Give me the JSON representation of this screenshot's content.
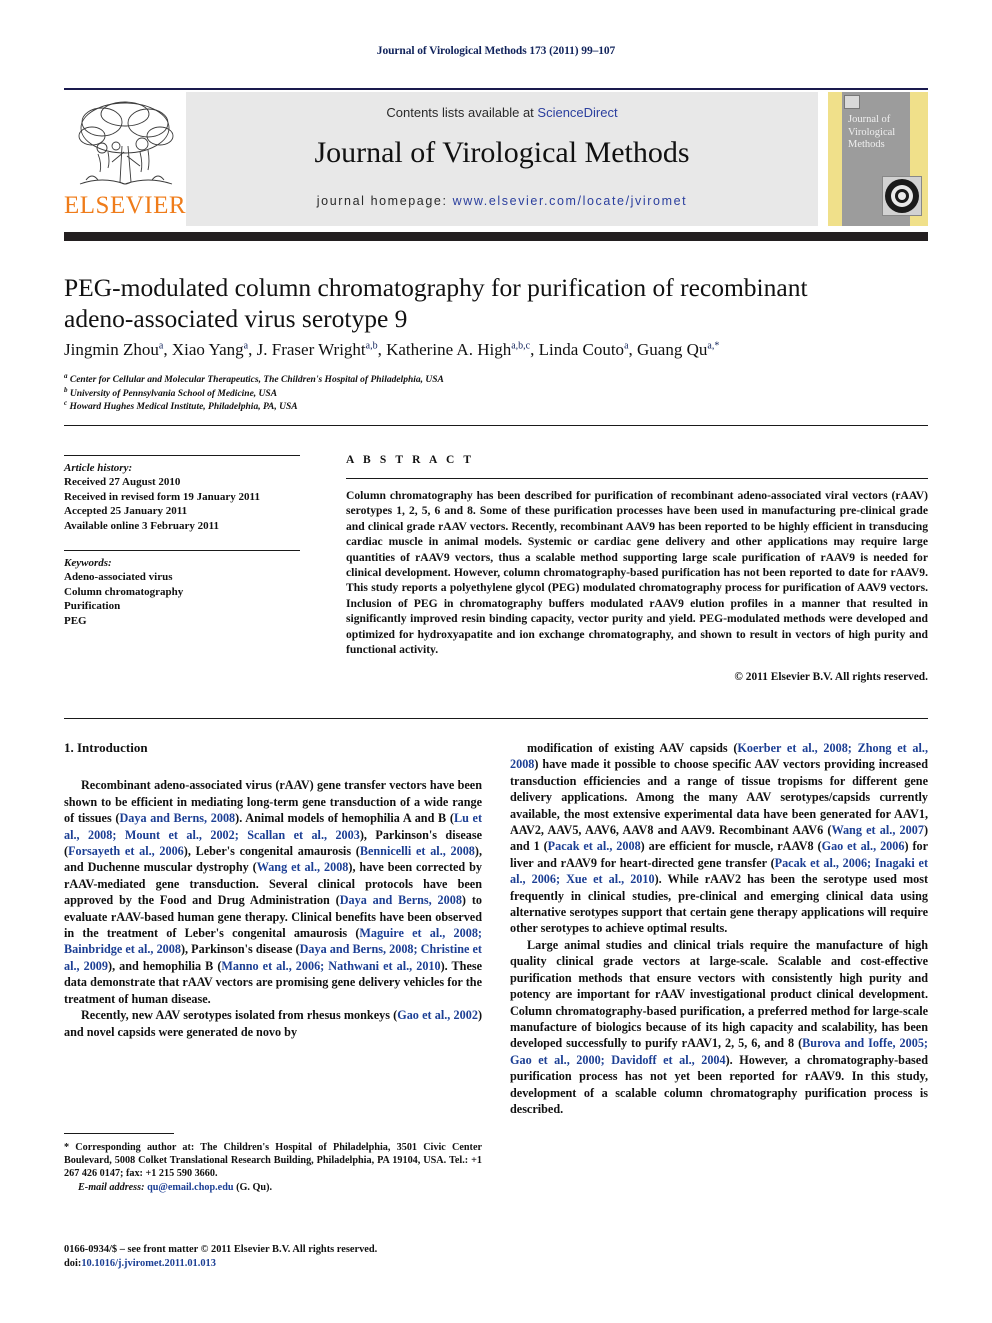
{
  "running_head": "Journal of Virological Methods 173 (2011) 99–107",
  "masthead": {
    "contents_prefix": "Contents lists available at ",
    "sciencedirect": "ScienceDirect",
    "journal_title": "Journal of Virological Methods",
    "homepage_label": "journal homepage:",
    "homepage_url": "www.elsevier.com/locate/jviromet",
    "publisher": "ELSEVIER",
    "cover_title": "Journal of Virological Methods",
    "accent_orange": "#ef7c1a",
    "link_blue": "#2b3f9e",
    "rule_navy": "#1a1a4e"
  },
  "article": {
    "title": "PEG-modulated column chromatography for purification of recombinant adeno-associated virus serotype 9",
    "authors": [
      {
        "name": "Jingmin Zhou",
        "sup": "a"
      },
      {
        "name": "Xiao Yang",
        "sup": "a"
      },
      {
        "name": "J. Fraser Wright",
        "sup": "a,b"
      },
      {
        "name": "Katherine A. High",
        "sup": "a,b,c"
      },
      {
        "name": "Linda Couto",
        "sup": "a"
      },
      {
        "name": "Guang Qu",
        "sup": "a,*"
      }
    ],
    "affiliations": [
      {
        "mark": "a",
        "text": "Center for Cellular and Molecular Therapeutics, The Children's Hospital of Philadelphia, USA"
      },
      {
        "mark": "b",
        "text": "University of Pennsylvania School of Medicine, USA"
      },
      {
        "mark": "c",
        "text": "Howard Hughes Medical Institute, Philadelphia, PA, USA"
      }
    ]
  },
  "info": {
    "history_heading": "Article history:",
    "history_lines": [
      "Received 27 August 2010",
      "Received in revised form 19 January 2011",
      "Accepted 25 January 2011",
      "Available online 3 February 2011"
    ],
    "keywords_heading": "Keywords:",
    "keywords": [
      "Adeno-associated virus",
      "Column chromatography",
      "Purification",
      "PEG"
    ]
  },
  "abstract": {
    "label": "A B S T R A C T",
    "body": "Column chromatography has been described for purification of recombinant adeno-associated viral vectors (rAAV) serotypes 1, 2, 5, 6 and 8. Some of these purification processes have been used in manufacturing pre-clinical grade and clinical grade rAAV vectors. Recently, recombinant AAV9 has been reported to be highly efficient in transducing cardiac muscle in animal models. Systemic or cardiac gene delivery and other applications may require large quantities of rAAV9 vectors, thus a scalable method supporting large scale purification of rAAV9 is needed for clinical development. However, column chromatography-based purification has not been reported to date for rAAV9. This study reports a polyethylene glycol (PEG) modulated chromatography process for purification of AAV9 vectors. Inclusion of PEG in chromatography buffers modulated rAAV9 elution profiles in a manner that resulted in significantly improved resin binding capacity, vector purity and yield. PEG-modulated methods were developed and optimized for hydroxyapatite and ion exchange chromatography, and shown to result in vectors of high purity and functional activity.",
    "copyright": "© 2011 Elsevier B.V. All rights reserved."
  },
  "body": {
    "section_heading": "1.  Introduction",
    "left_paragraphs": [
      "Recombinant adeno-associated virus (rAAV) gene transfer vectors have been shown to be efficient in mediating long-term gene transduction of a wide range of tissues (Daya and Berns, 2008). Animal models of hemophilia A and B (Lu et al., 2008; Mount et al., 2002; Scallan et al., 2003), Parkinson's disease (Forsayeth et al., 2006), Leber's congenital amaurosis (Bennicelli et al., 2008), and Duchenne muscular dystrophy (Wang et al., 2008), have been corrected by rAAV-mediated gene transduction. Several clinical protocols have been approved by the Food and Drug Administration (Daya and Berns, 2008) to evaluate rAAV-based human gene therapy. Clinical benefits have been observed in the treatment of Leber's congenital amaurosis (Maguire et al., 2008; Bainbridge et al., 2008), Parkinson's disease (Daya and Berns, 2008; Christine et al., 2009), and hemophilia B (Manno et al., 2006; Nathwani et al., 2010). These data demonstrate that rAAV vectors are promising gene delivery vehicles for the treatment of human disease.",
      "Recently, new AAV serotypes isolated from rhesus monkeys (Gao et al., 2002) and novel capsids were generated de novo by"
    ],
    "right_paragraphs": [
      "modification of existing AAV capsids (Koerber et al., 2008; Zhong et al., 2008) have made it possible to choose specific AAV vectors providing increased transduction efficiencies and a range of tissue tropisms for different gene delivery applications. Among the many AAV serotypes/capsids currently available, the most extensive experimental data have been generated for AAV1, AAV2, AAV5, AAV6, AAV8 and AAV9. Recombinant AAV6 (Wang et al., 2007) and 1 (Pacak et al., 2008) are efficient for muscle, rAAV8 (Gao et al., 2006) for liver and rAAV9 for heart-directed gene transfer (Pacak et al., 2006; Inagaki et al., 2006; Xue et al., 2010). While rAAV2 has been the serotype used most frequently in clinical studies, pre-clinical and emerging clinical data using alternative serotypes support that certain gene therapy applications will require other serotypes to achieve optimal results.",
      "Large animal studies and clinical trials require the manufacture of high quality clinical grade vectors at large-scale. Scalable and cost-effective purification methods that ensure vectors with consistently high purity and potency are important for rAAV investigational product clinical development. Column chromatography-based purification, a preferred method for large-scale manufacture of biologics because of its high capacity and scalability, has been developed successfully to purify rAAV1, 2, 5, 6, and 8 (Burova and Ioffe, 2005; Gao et al., 2000; Davidoff et al., 2004). However, a chromatography-based purification process has not yet been reported for rAAV9. In this study, development of a scalable column chromatography purification process is described."
    ]
  },
  "footnote": {
    "corresponding": "* Corresponding author at: The Children's Hospital of Philadelphia, 3501 Civic Center Boulevard, 5008 Colket Translational Research Building, Philadelphia, PA 19104, USA. Tel.: +1 267 426 0147; fax: +1 215 590 3660.",
    "email_label": "E-mail address:",
    "email": "qu@email.chop.edu",
    "email_suffix": "(G. Qu).",
    "issn_line": "0166-0934/$ – see front matter © 2011 Elsevier B.V. All rights reserved.",
    "doi_label": "doi:",
    "doi": "10.1016/j.jviromet.2011.01.013"
  }
}
